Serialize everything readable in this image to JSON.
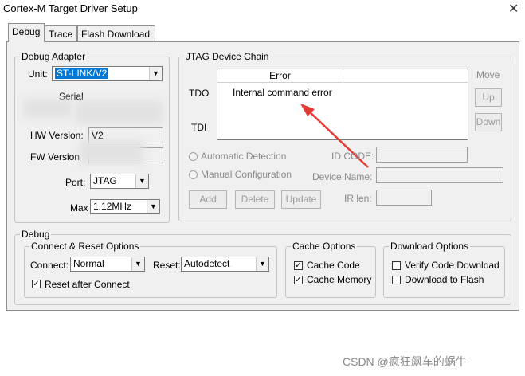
{
  "window": {
    "title": "Cortex-M Target Driver Setup",
    "close_glyph": "✕"
  },
  "tabs": [
    {
      "label": "Debug"
    },
    {
      "label": "Trace"
    },
    {
      "label": "Flash Download"
    }
  ],
  "debug_adapter": {
    "legend": "Debug Adapter",
    "unit_label": "Unit:",
    "unit_value": "ST-LINK/V2",
    "serial_label": "Serial",
    "hw_label": "HW Version:",
    "hw_value": "V2",
    "fw_label": "FW Version",
    "port_label": "Port:",
    "port_value": "JTAG",
    "max_label": "Max",
    "max_value": "1.12MHz"
  },
  "jtag": {
    "legend": "JTAG Device Chain",
    "tdo": "TDO",
    "tdi": "TDI",
    "column_header": "Error",
    "error_text": "Internal command error",
    "move_label": "Move",
    "up_button": "Up",
    "down_button": "Down",
    "auto_detect": "Automatic Detection",
    "manual_config": "Manual Configuration",
    "id_code_label": "ID CODE:",
    "device_name_label": "Device Name:",
    "ir_len_label": "IR len:",
    "add_button": "Add",
    "delete_button": "Delete",
    "update_button": "Update"
  },
  "debug": {
    "legend": "Debug",
    "connect_reset": {
      "legend": "Connect & Reset Options",
      "connect_label": "Connect:",
      "connect_value": "Normal",
      "reset_label": "Reset:",
      "reset_value": "Autodetect",
      "reset_after_connect": "Reset after Connect"
    },
    "cache": {
      "legend": "Cache Options",
      "cache_code": "Cache Code",
      "cache_memory": "Cache Memory"
    },
    "download": {
      "legend": "Download Options",
      "verify": "Verify Code Download",
      "download_flash": "Download to Flash"
    }
  },
  "watermark": "CSDN @疯狂飙车的蜗牛",
  "colors": {
    "selection": "#0078d7",
    "annotation_arrow": "#e53935"
  }
}
